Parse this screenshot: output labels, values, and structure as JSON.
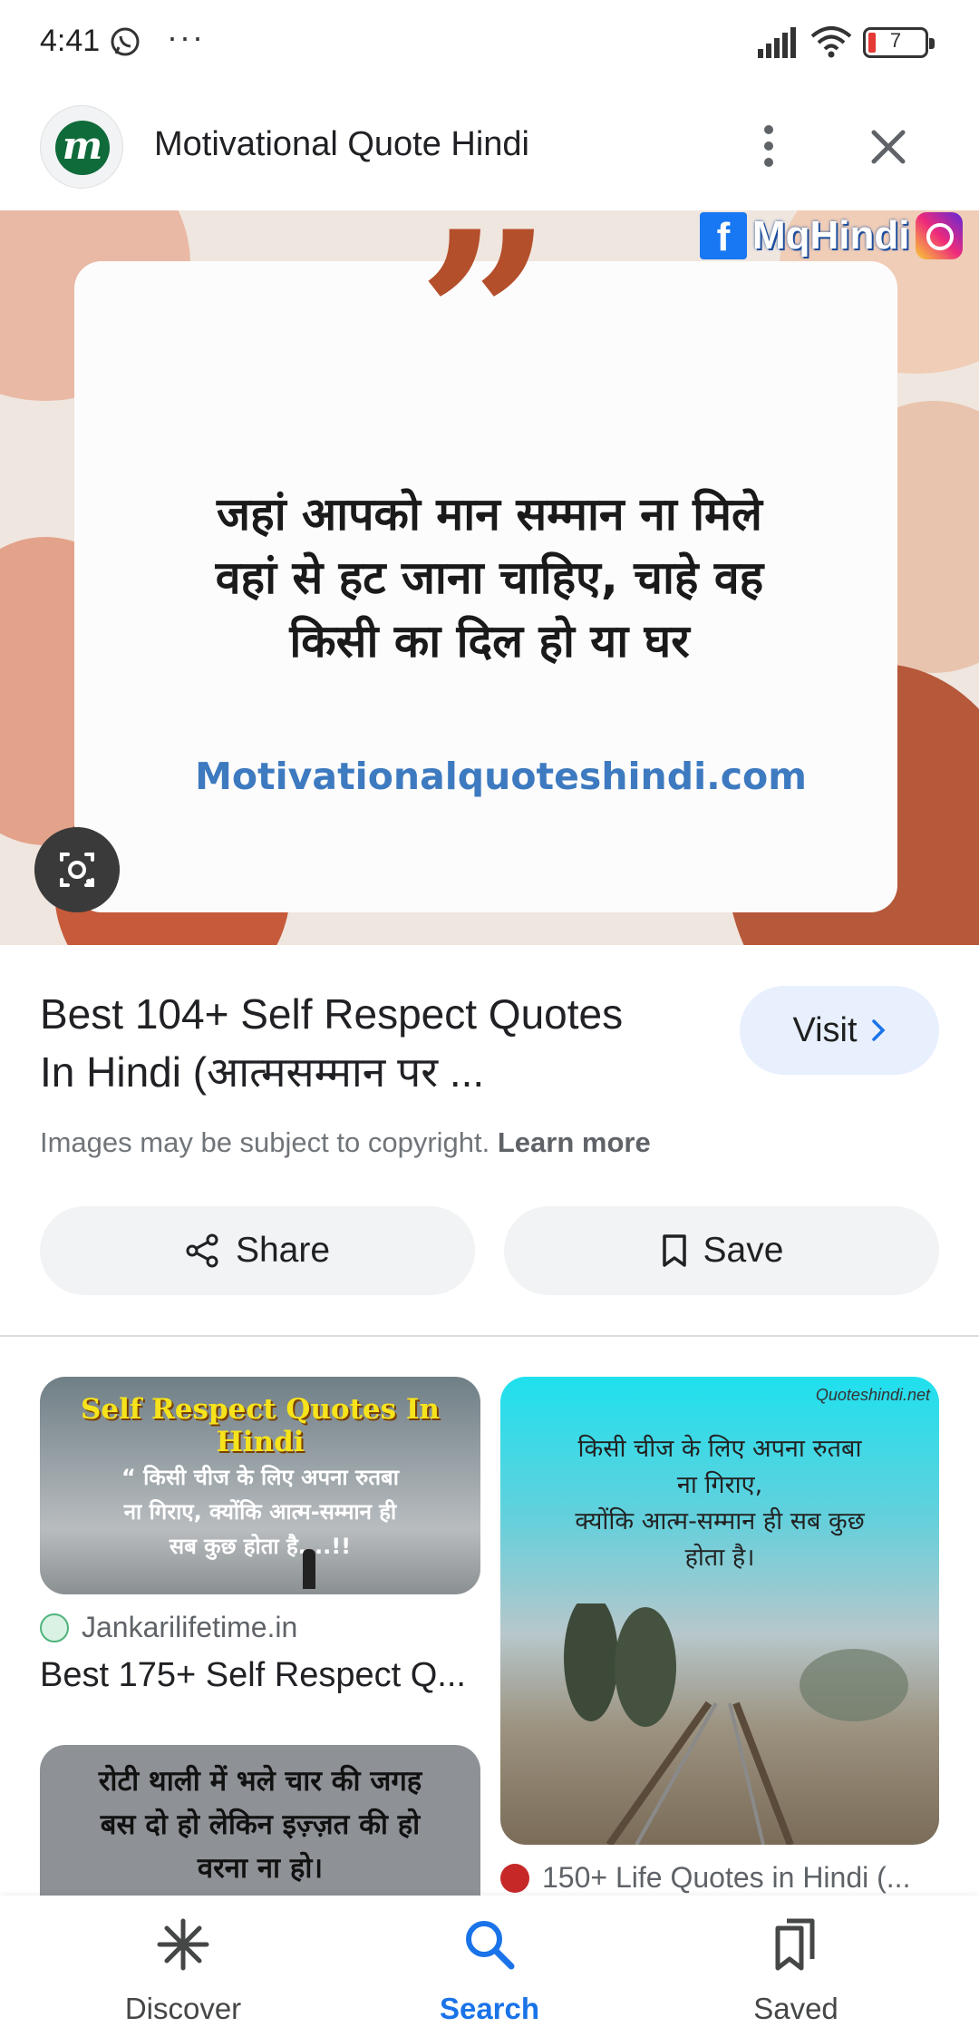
{
  "status_bar": {
    "time": "4:41",
    "more": "···",
    "battery": "7"
  },
  "header": {
    "site_logo_letter": "m",
    "site_title": "Motivational Quote Hindi"
  },
  "hero": {
    "quote_text_line1": "जहां आपको मान सम्मान ना मिले",
    "quote_text_line2": "वहां से हट जाना चाहिए, चाहे वह",
    "quote_text_line3": "किसी का दिल हो या घर",
    "site_url": "Motivationalquoteshindi.com",
    "badge_text": "MqHindi",
    "colors": {
      "accent": "#b44f2b",
      "link": "#3d7ac0"
    }
  },
  "result": {
    "title_line1": "Best 104+ Self Respect Quotes",
    "title_line2": "In Hindi (आत्मसम्मान पर ...",
    "visit_label": "Visit",
    "copyright_text": "Images may be subject to copyright.",
    "learn_more": "Learn more",
    "share_label": "Share",
    "save_label": "Save"
  },
  "related": [
    {
      "image_title": "Self Respect Quotes In Hindi",
      "image_text_line1": "“ किसी चीज के लिए अपना रुतबा",
      "image_text_line2": "ना गिराए, क्योंकि आत्म-सम्मान ही",
      "image_text_line3": "सब कुछ होता है....!!",
      "source": "Jankarilifetime.in",
      "title": "Best 175+ Self Respect Q..."
    },
    {
      "watermark": "Quoteshindi.net",
      "image_text_line1": "किसी चीज के लिए अपना रुतबा",
      "image_text_line2": "ना गिराए,",
      "image_text_line3": "क्योंकि आत्म-सम्मान ही सब कुछ",
      "image_text_line4": "होता है।",
      "title": "150+ Life Quotes in Hindi (..."
    },
    {
      "image_text_line1": "रोटी थाली में भले चार की जगह",
      "image_text_line2": "बस दो हो लेकिन इज़्ज़त की हो",
      "image_text_line3": "वरना ना हो।"
    }
  ],
  "bottom_nav": {
    "items": [
      {
        "label": "Discover",
        "icon": "asterisk-icon"
      },
      {
        "label": "Search",
        "icon": "search-icon",
        "active": true
      },
      {
        "label": "Saved",
        "icon": "bookmarks-icon"
      }
    ]
  }
}
